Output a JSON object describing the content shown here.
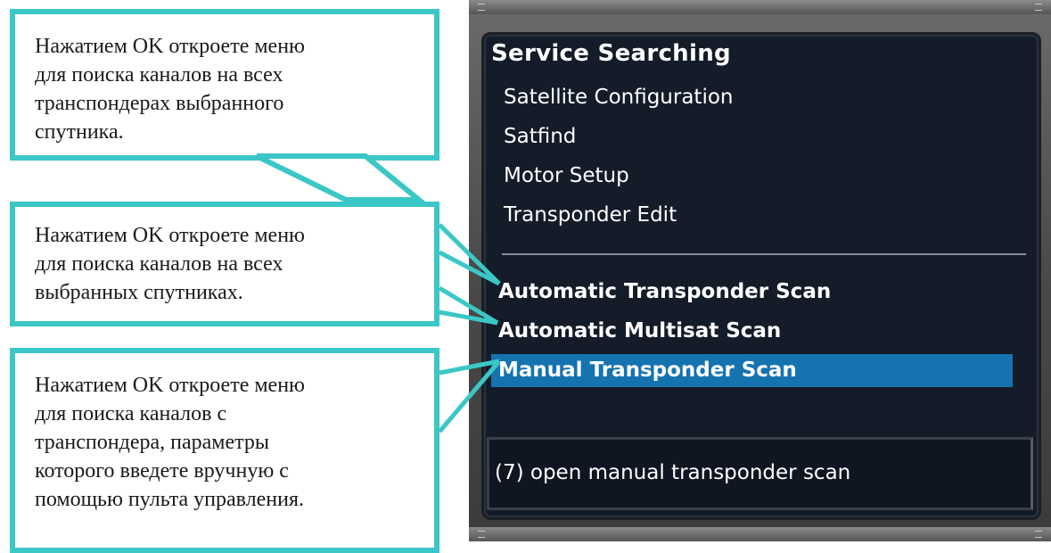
{
  "callouts": [
    {
      "text": "Нажатием OK откроете меню\nдля поиска  каналов на всех\nтранспондерах выбранного\nспутника."
    },
    {
      "text": "Нажатием OK откроете меню\nдля поиска  каналов на всех\nвыбранных спутниках."
    },
    {
      "text": "Нажатием OK откроете меню\nдля поиска  каналов с\nтранспондера, параметры\nкоторого введете вручную с\nпомощью пульта управления."
    }
  ],
  "menu": {
    "title": "Service Searching",
    "items": [
      {
        "label": "Satellite Configuration",
        "selected": false
      },
      {
        "label": "Satfind",
        "selected": false
      },
      {
        "label": "Motor Setup",
        "selected": false
      },
      {
        "label": "Transponder Edit",
        "selected": false
      },
      {
        "label": "Automatic Transponder Scan",
        "selected": false
      },
      {
        "label": "Automatic Multisat Scan",
        "selected": false
      },
      {
        "label": "Manual Transponder Scan",
        "selected": true
      }
    ],
    "help": "(7) open manual transponder scan"
  },
  "colors": {
    "accent": "#3cc7c7",
    "selection": "#1573b0",
    "screen_bg": "#141b29"
  }
}
